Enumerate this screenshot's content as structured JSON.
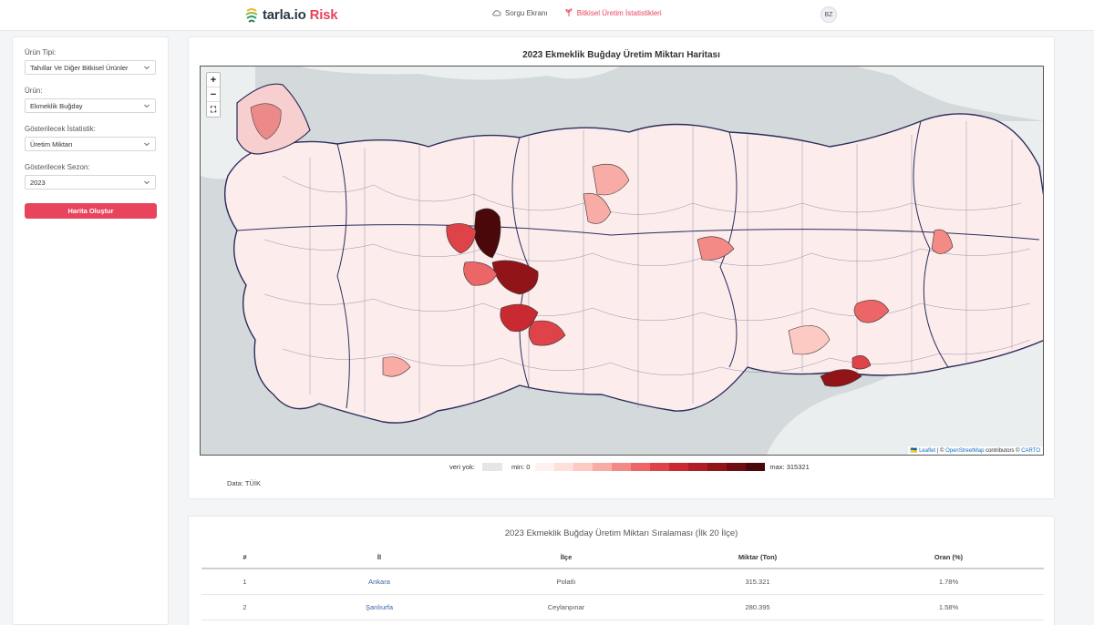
{
  "brand": {
    "name": "tarla.io",
    "accent": "Risk",
    "accent_color": "#e8445e"
  },
  "nav": {
    "items": [
      {
        "label": "Sorgu Ekranı",
        "icon": "cloud-icon",
        "active": false
      },
      {
        "label": "Bitkisel Üretim İstatistikleri",
        "icon": "plant-icon",
        "active": true
      }
    ],
    "avatar": "BZ"
  },
  "sidebar": {
    "fields": [
      {
        "label": "Ürün Tipi:",
        "value": "Tahıllar Ve Diğer Bitkisel Ürünler"
      },
      {
        "label": "Ürün:",
        "value": "Ekmeklik Buğday"
      },
      {
        "label": "Gösterilecek İstatistik:",
        "value": "Üretim Miktarı"
      },
      {
        "label": "Gösterilecek Sezon:",
        "value": "2023"
      }
    ],
    "button": "Harita Oluştur"
  },
  "map": {
    "title": "2023 Ekmeklik Buğday Üretim Miktarı Haritası",
    "zoom_in": "+",
    "zoom_out": "−",
    "fullscreen": "⛶",
    "attribution": {
      "leaflet": "Leaflet",
      "sep1": " | © ",
      "osm": "OpenStreetMap",
      "sep2": " contributors © ",
      "carto": "CARTO"
    },
    "legend": {
      "no_data_label": "veri yok:",
      "min_label": "min: 0",
      "max_label": "max: 315321",
      "colors": [
        "#fff1f0",
        "#fde0dc",
        "#fcc9c3",
        "#f9aba5",
        "#f48a86",
        "#ec6667",
        "#de4349",
        "#c92a31",
        "#b01d24",
        "#911419",
        "#6e0d12",
        "#4a080a"
      ]
    },
    "source": "Data: TÜİK"
  },
  "ranking": {
    "title": "2023 Ekmeklik Buğday Üretim Miktarı Sıralaması (İlk 20 İlçe)",
    "columns": [
      "#",
      "İl",
      "İlçe",
      "Miktar (Ton)",
      "Oran (%)"
    ],
    "rows": [
      [
        "1",
        "Ankara",
        "Polatlı",
        "315.321",
        "1.78%"
      ],
      [
        "2",
        "Şanlıurfa",
        "Ceylanpınar",
        "280.395",
        "1.58%"
      ]
    ]
  }
}
